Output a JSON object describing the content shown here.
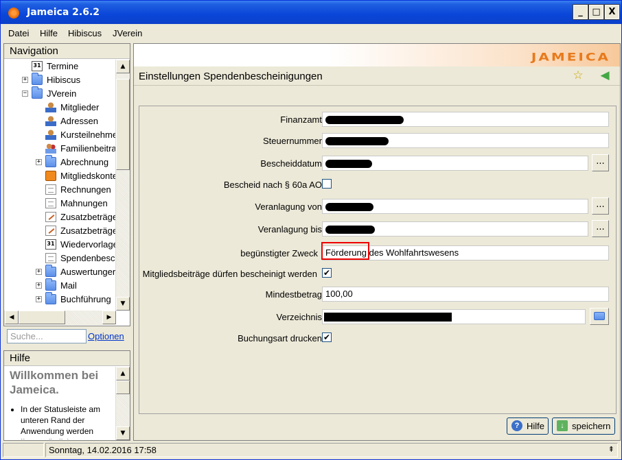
{
  "window": {
    "title": "Jameica 2.6.2",
    "min": "_",
    "max": "□",
    "close": "X"
  },
  "menu": [
    "Datei",
    "Hilfe",
    "Hibiscus",
    "JVerein"
  ],
  "navigation": {
    "title": "Navigation",
    "items": [
      {
        "label": "Termine",
        "icon": "calendar-icon"
      },
      {
        "label": "Hibiscus",
        "icon": "folder-icon",
        "expander": "+"
      },
      {
        "label": "JVerein",
        "icon": "folder-icon",
        "expander": "−"
      },
      {
        "label": "Mitglieder",
        "icon": "user-icon"
      },
      {
        "label": "Adressen",
        "icon": "user-icon"
      },
      {
        "label": "Kursteilnehme",
        "icon": "user-icon"
      },
      {
        "label": "Familienbeitra",
        "icon": "family-icon"
      },
      {
        "label": "Abrechnung",
        "icon": "folder-icon",
        "expander": "+"
      },
      {
        "label": "Mitgliedskonte",
        "icon": "money-icon"
      },
      {
        "label": "Rechnungen",
        "icon": "document-icon"
      },
      {
        "label": "Mahnungen",
        "icon": "document-icon"
      },
      {
        "label": "Zusatzbeträge",
        "icon": "edit-icon"
      },
      {
        "label": "Zusatzbeträge",
        "icon": "edit-icon"
      },
      {
        "label": "Wiedervorlage",
        "icon": "calendar-icon"
      },
      {
        "label": "Spendenbesch",
        "icon": "document-icon"
      },
      {
        "label": "Auswertunger",
        "icon": "folder-icon",
        "expander": "+"
      },
      {
        "label": "Mail",
        "icon": "folder-icon",
        "expander": "+"
      },
      {
        "label": "Buchführung",
        "icon": "folder-icon",
        "expander": "+"
      }
    ]
  },
  "search": {
    "placeholder": "Suche...",
    "options_link": "Optionen"
  },
  "help": {
    "title": "Hilfe",
    "heading": "Willkommen bei Jameica.",
    "text": "In der Statusleiste am unteren Rand der Anwendung werden Ihnen nützliche"
  },
  "banner": {
    "logo": "JAMEICA"
  },
  "page": {
    "title": "Einstellungen Spendenbescheinigungen"
  },
  "form": {
    "finanzamt": {
      "label": "Finanzamt"
    },
    "steuernummer": {
      "label": "Steuernummer"
    },
    "bescheiddatum": {
      "label": "Bescheiddatum",
      "button": "..."
    },
    "bescheid60a": {
      "label": "Bescheid nach § 60a AO",
      "checked": false
    },
    "veranlagung_von": {
      "label": "Veranlagung von",
      "button": "..."
    },
    "veranlagung_bis": {
      "label": "Veranlagung bis",
      "button": "..."
    },
    "zweck": {
      "label": "begünstigter Zweck",
      "value_highlight": "Förderung",
      "value_rest": " des Wohlfahrtswesens"
    },
    "mitgliedsbeitraege": {
      "label": "Mitgliedsbeiträge dürfen bescheinigt werden",
      "checked": true,
      "mark": "✔"
    },
    "mindestbetrag": {
      "label": "Mindestbetrag",
      "value": "100,00"
    },
    "verzeichnis": {
      "label": "Verzeichnis"
    },
    "buchungsart": {
      "label": "Buchungsart drucken",
      "checked": true,
      "mark": "✔"
    }
  },
  "buttons": {
    "help": "Hilfe",
    "save": "speichern"
  },
  "status": {
    "datetime": "Sonntag, 14.02.2016 17:58"
  }
}
